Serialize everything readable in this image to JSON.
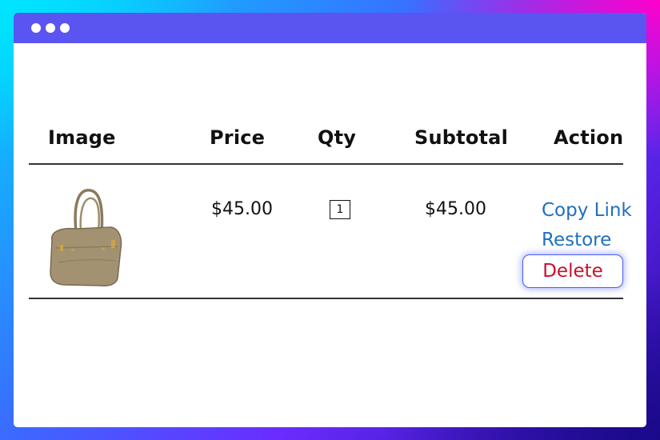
{
  "table": {
    "headers": {
      "image": "Image",
      "price": "Price",
      "qty": "Qty",
      "subtotal": "Subtotal",
      "action": "Action"
    },
    "rows": [
      {
        "product_icon": "handbag-icon",
        "price": "$45.00",
        "qty": "1",
        "subtotal": "$45.00",
        "actions": {
          "copy_link": "Copy Link",
          "restore": "Restore",
          "delete": "Delete"
        }
      }
    ]
  },
  "colors": {
    "titlebar": "#5a54f0",
    "link": "#1f6fbf",
    "delete": "#c8102e"
  }
}
